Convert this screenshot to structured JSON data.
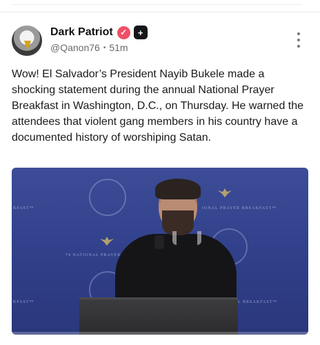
{
  "post": {
    "author_name": "Dark Patriot",
    "verified_icon": "check-badge-icon",
    "plus_icon": "plus-badge-icon",
    "handle": "@Qanon76",
    "separator": "•",
    "time_ago": "51m",
    "body": "Wow! El Salvador’s President Nayib Bukele made a shocking statement during the annual National Prayer Breakfast in Washington, D.C., on Thursday. He warned the attendees that violent gang members in his country have a documented history of worshiping Satan."
  },
  "media": {
    "banner_left": "KFAST™",
    "banner_right": "IONAL PRAYER BREAKFAST™",
    "banner_mid": "74 NATIONAL PRAYER BR",
    "banner_bottom_left": "KFAST™",
    "banner_bottom_right": "L BREAKFAST™"
  },
  "colors": {
    "verified": "#ef4f66",
    "plus_badge": "#16161a",
    "backdrop": "#34438d"
  }
}
